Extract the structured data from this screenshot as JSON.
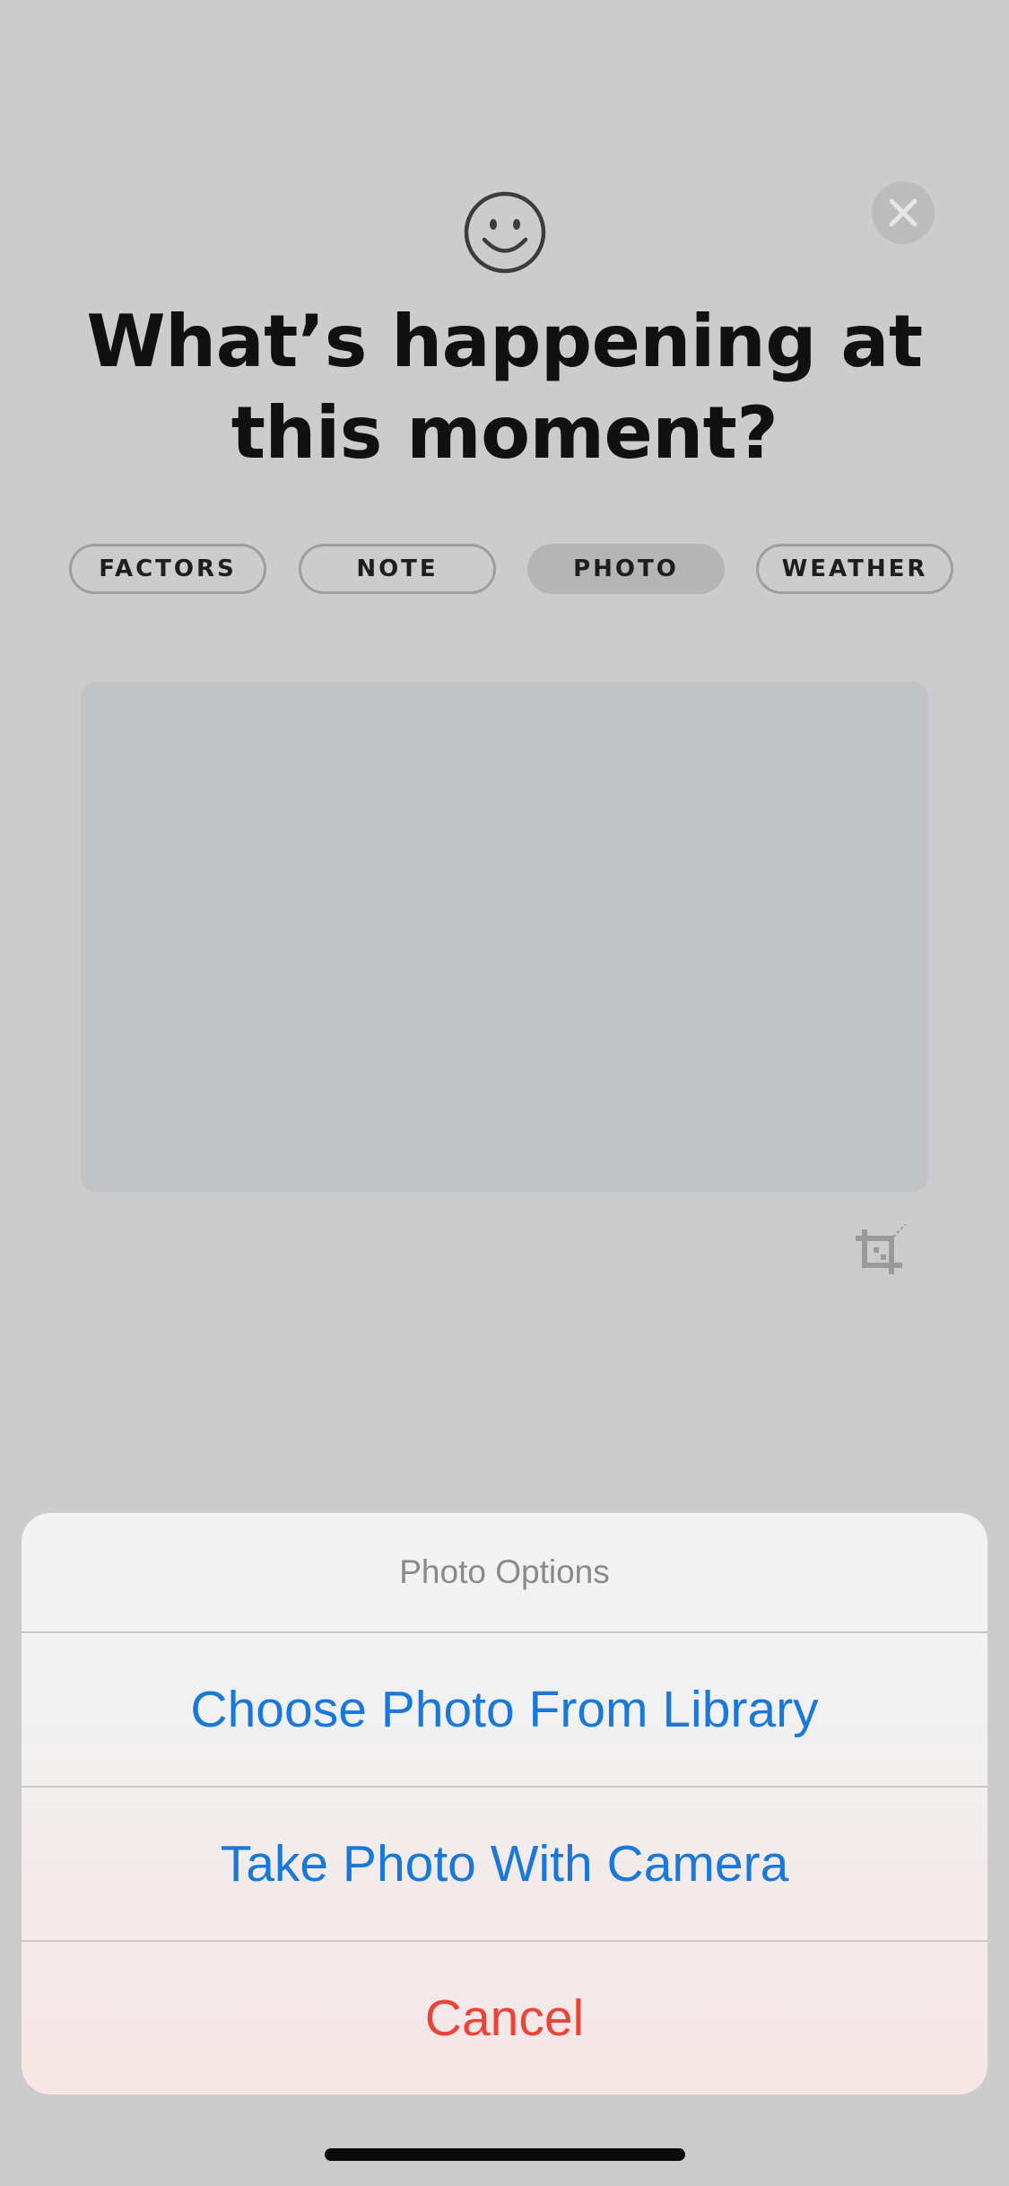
{
  "header": {
    "title_line1": "What’s happening at",
    "title_line2": "this moment?"
  },
  "tabs": [
    {
      "label": "FACTORS",
      "active": false
    },
    {
      "label": "NOTE",
      "active": false
    },
    {
      "label": "PHOTO",
      "active": true
    },
    {
      "label": "WEATHER",
      "active": false
    }
  ],
  "icons": {
    "mood": "smiley-face-icon",
    "close": "close-icon",
    "crop": "crop-icon"
  },
  "action_sheet": {
    "title": "Photo Options",
    "actions": [
      {
        "label": "Choose Photo From Library",
        "style": "default"
      },
      {
        "label": "Take Photo With Camera",
        "style": "default"
      },
      {
        "label": "Cancel",
        "style": "destructive"
      }
    ]
  },
  "colors": {
    "background": "#cccccc",
    "action_blue": "#1a78d8",
    "destructive_red": "#e8443a",
    "active_tab": "#b5b5b5"
  }
}
